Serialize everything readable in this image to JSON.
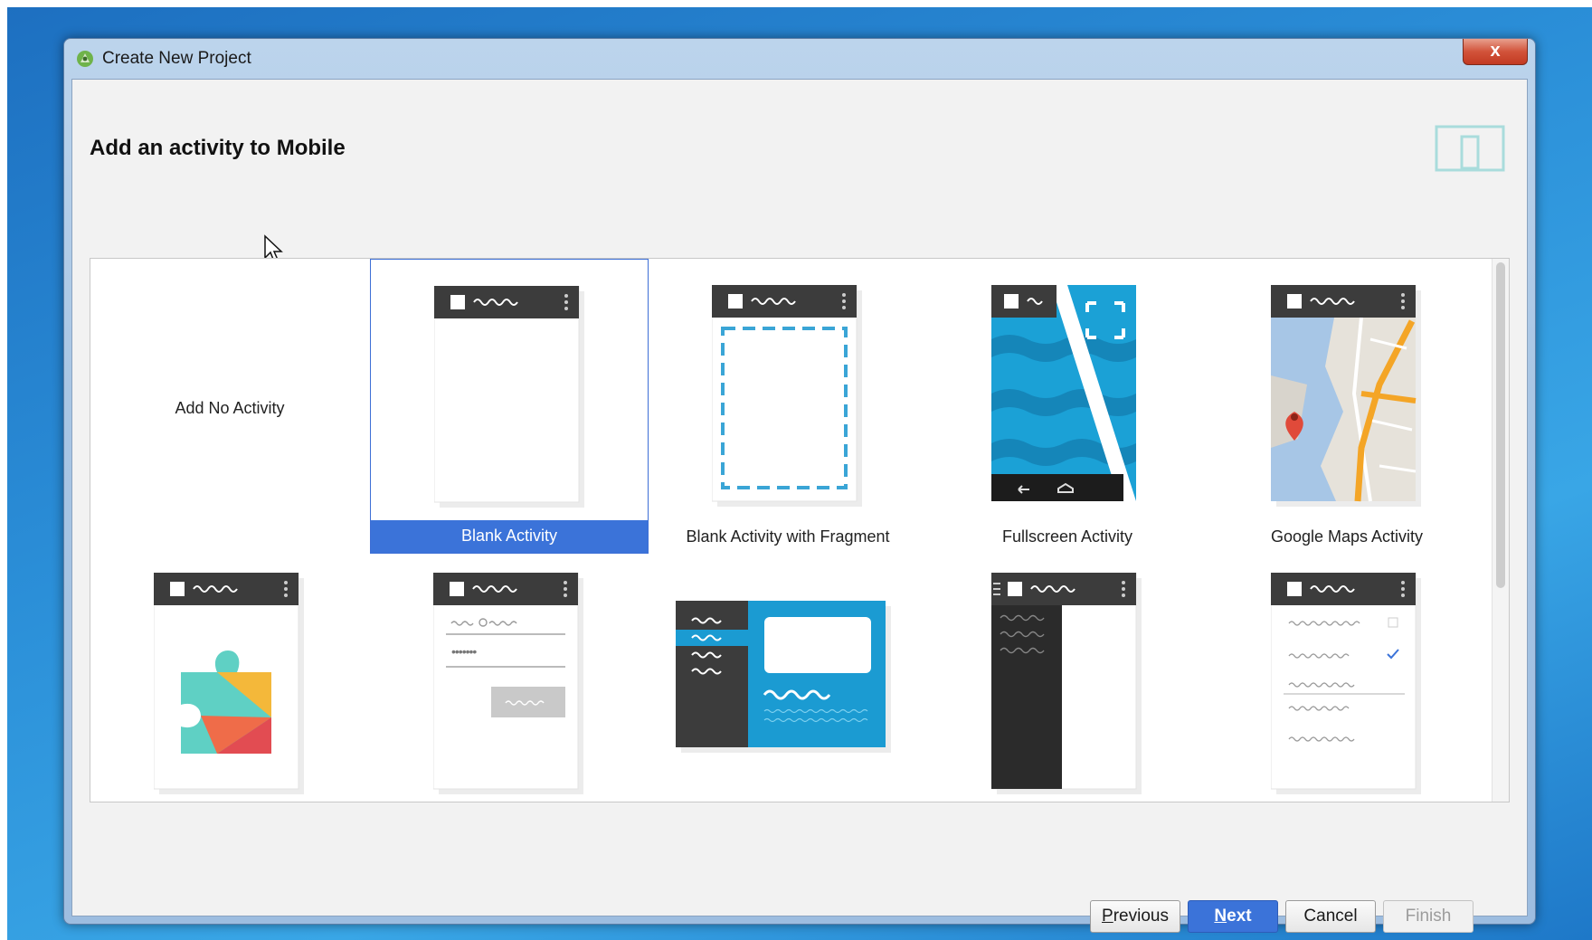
{
  "window": {
    "title": "Create New Project",
    "close_label": "x"
  },
  "page": {
    "heading": "Add an activity to Mobile"
  },
  "gallery": {
    "tiles": [
      {
        "label": "Add No Activity"
      },
      {
        "label": "Blank Activity",
        "selected": true
      },
      {
        "label": "Blank Activity with Fragment"
      },
      {
        "label": "Fullscreen Activity"
      },
      {
        "label": "Google Maps Activity"
      }
    ],
    "login_thumb_password": "•••••••"
  },
  "buttons": {
    "previous": {
      "mnemonic": "P",
      "rest": "revious"
    },
    "next": {
      "mnemonic": "N",
      "rest": "ext"
    },
    "cancel": "Cancel",
    "finish": "Finish"
  },
  "colors": {
    "accent": "#3b73d9",
    "thumb_bar": "#3c3c3c",
    "blue_fill": "#1ba1d6"
  }
}
